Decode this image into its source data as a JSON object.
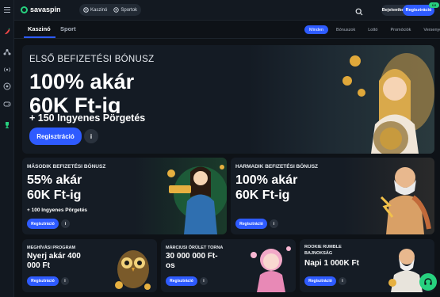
{
  "header": {
    "logo_text": "savaspin",
    "modes": [
      {
        "label": "Kaszinó",
        "icon": "casino-chip-icon"
      },
      {
        "label": "Sportok",
        "icon": "soccer-ball-icon"
      }
    ],
    "login_label": "Bejelentkezés",
    "register_label": "Regisztráció",
    "register_badge": "ÚJ"
  },
  "main_tabs": [
    {
      "label": "Kaszinó",
      "active": true
    },
    {
      "label": "Sport",
      "active": false
    }
  ],
  "filters": [
    {
      "label": "Minden",
      "active": true
    },
    {
      "label": "Bónuszok",
      "active": false
    },
    {
      "label": "Lottó",
      "active": false
    },
    {
      "label": "Promóciók",
      "active": false
    },
    {
      "label": "Versenyek",
      "active": false
    }
  ],
  "sidebar_icons": [
    "menu-icon",
    "chili-icon",
    "nodes-icon",
    "broadcast-icon",
    "soccer-ball-icon",
    "gamepad-icon",
    "trophy-icon"
  ],
  "hero": {
    "eyebrow": "ELSŐ BEFIZETÉSI BÓNUSZ",
    "headline_line1": "100% akár",
    "headline_line2": "60K Ft-ig",
    "sub": "+ 150 Ingyenes Pörgetés",
    "cta": "Regisztráció",
    "info": "i"
  },
  "promo2": {
    "eyebrow": "MÁSODIK BEFIZETÉSI BÓNUSZ",
    "headline_line1": "55% akár",
    "headline_line2": "60K Ft-ig",
    "sub": "+ 100 Ingyenes Pörgetés",
    "cta": "Regisztráció",
    "info": "i"
  },
  "promo3": {
    "eyebrow": "HARMADIK BEFIZETÉSI BÓNUSZ",
    "headline_line1": "100% akár",
    "headline_line2": "60K Ft-ig",
    "cta": "Regisztráció",
    "info": "i"
  },
  "promo4": {
    "eyebrow": "MEGHÍVÁSI PROGRAM",
    "headline_line1": "Nyerj akár 400",
    "headline_line2": "000 Ft",
    "cta": "Regisztráció",
    "info": "i"
  },
  "promo5": {
    "eyebrow": "MÁRCIUSI ÖRÜLET TORNA",
    "headline_line1": "30 000 000 Ft-",
    "headline_line2": "os",
    "cta": "Regisztráció",
    "info": "i"
  },
  "promo6": {
    "eyebrow_line1": "ROOKIE RUMBLE",
    "eyebrow_line2": "BAJNOKSÁG",
    "headline_line1": "Napi 1 000K Ft",
    "cta": "Regisztráció",
    "info": "i"
  },
  "colors": {
    "accent": "#2e5bff",
    "brand_green": "#27d17f",
    "background": "#0e1217",
    "card": "#151c25"
  }
}
